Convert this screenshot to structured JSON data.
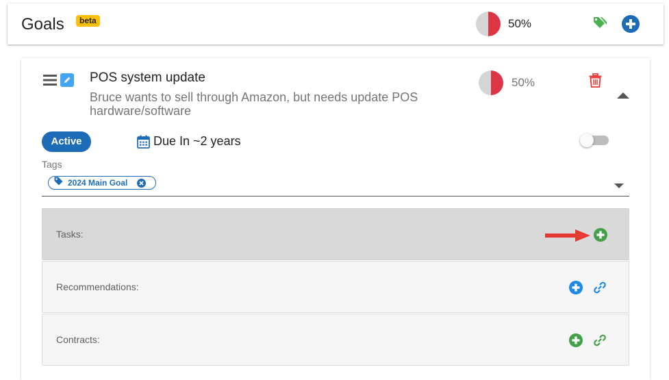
{
  "header": {
    "title": "Goals",
    "badge": "beta",
    "progress_percent": 50,
    "progress_label": "50%",
    "tag_icon": "tags-icon",
    "add_icon": "plus-circle-icon"
  },
  "goal": {
    "title": "POS system update",
    "description": "Bruce wants to sell through Amazon, but needs update POS hardware/software",
    "progress_percent": 50,
    "progress_label": "50%",
    "status": "Active",
    "due_label": "Due In ~2 years",
    "tags_label": "Tags",
    "tags": [
      {
        "label": "2024 Main Goal"
      }
    ],
    "sections": {
      "tasks": {
        "label": "Tasks:"
      },
      "recommendations": {
        "label": "Recommendations:"
      },
      "contracts": {
        "label": "Contracts:"
      }
    }
  },
  "colors": {
    "pie_filled": "#dc3545",
    "pie_empty": "#d5d5d5",
    "primary": "#1e6bb8",
    "blue_button": "#1e88e5",
    "green_button": "#43a047",
    "tag_green": "#4caf50",
    "trash_red": "#e53935",
    "annotation_arrow": "#e53935",
    "beta_badge": "#ffc107"
  }
}
